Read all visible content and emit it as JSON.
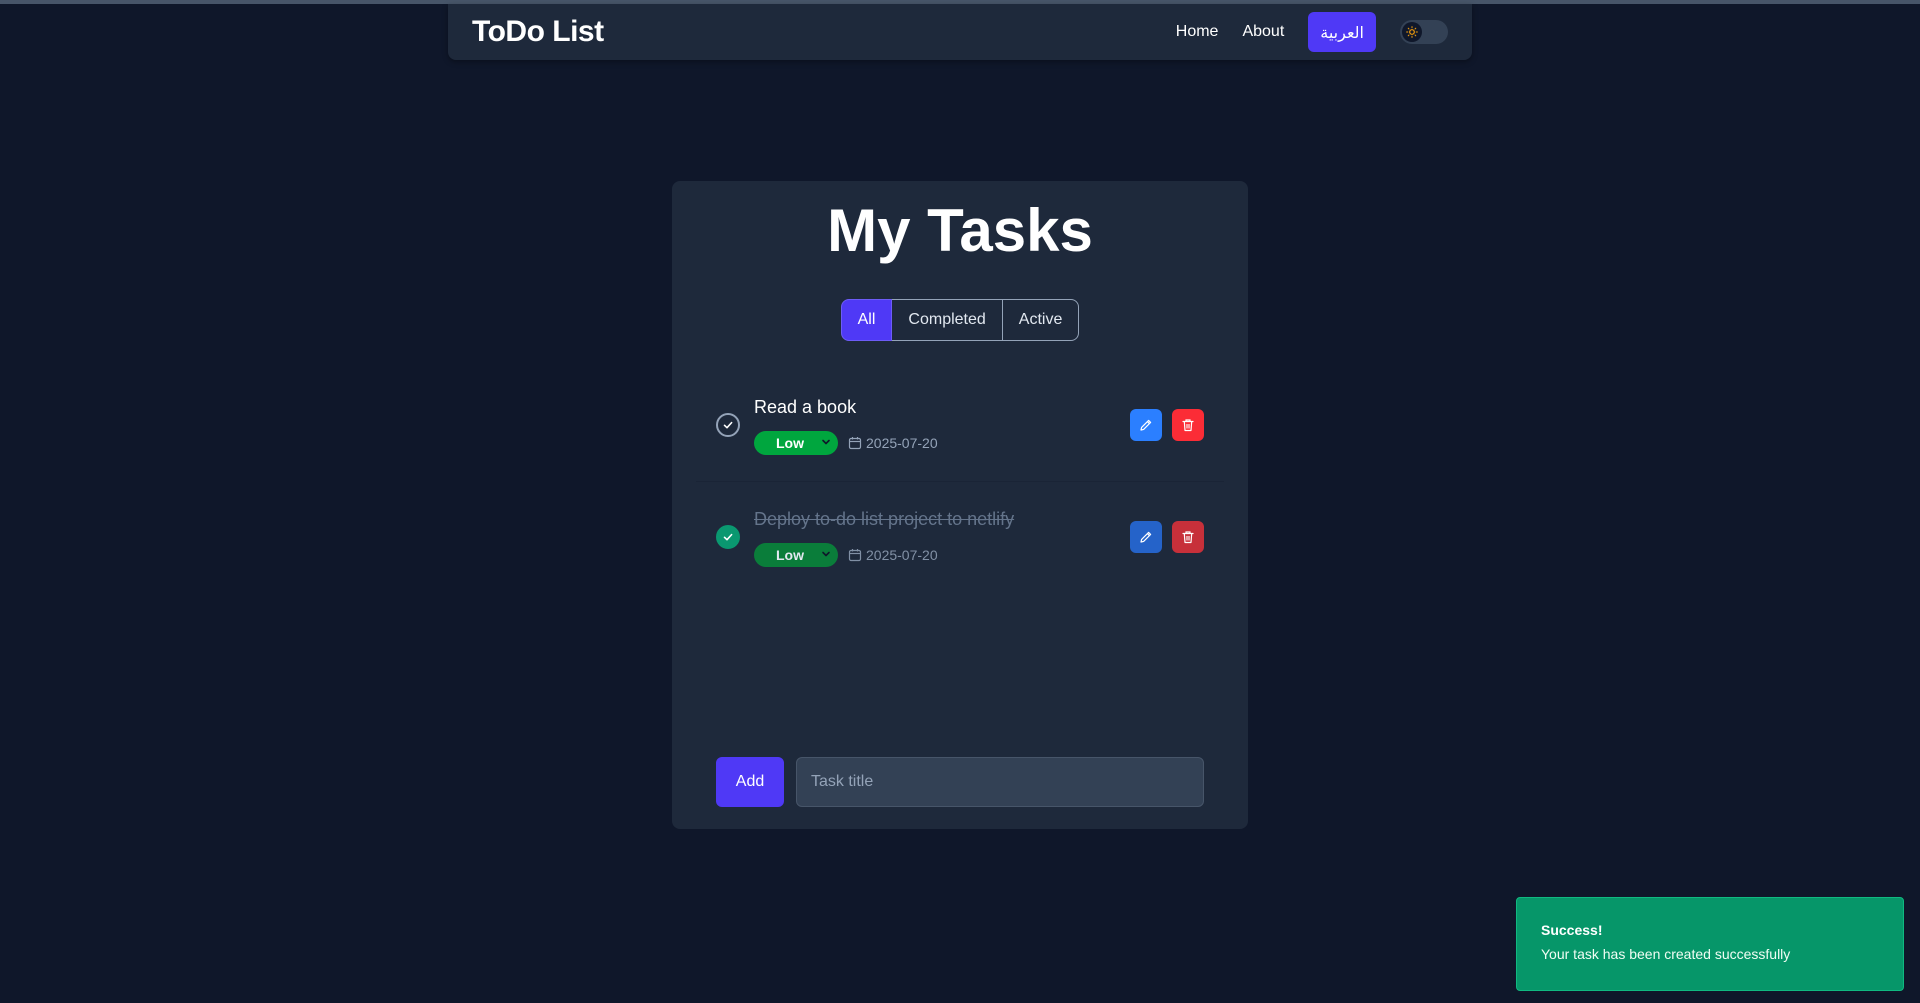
{
  "navbar": {
    "brand": "ToDo List",
    "links": [
      "Home",
      "About"
    ],
    "language_button": "العربية",
    "theme_toggle_icon": "sun-icon"
  },
  "main": {
    "title": "My Tasks",
    "filters": [
      "All",
      "Completed",
      "Active"
    ],
    "active_filter": "All",
    "tasks": [
      {
        "title": "Read a book",
        "priority": "Low",
        "date": "2025-07-20",
        "completed": false
      },
      {
        "title": "Deploy to-do list project to netlify",
        "priority": "Low",
        "date": "2025-07-20",
        "completed": true
      }
    ],
    "add_button": "Add",
    "input_placeholder": "Task title",
    "input_value": ""
  },
  "toast": {
    "title": "Success!",
    "message": "Your task has been created successfully"
  },
  "colors": {
    "background": "#0f172a",
    "surface": "#1e293b",
    "accent": "#4f39f6",
    "priority_low": "#00a63e",
    "edit": "#2b7fff",
    "delete": "#fb2c36",
    "success": "#069669"
  }
}
